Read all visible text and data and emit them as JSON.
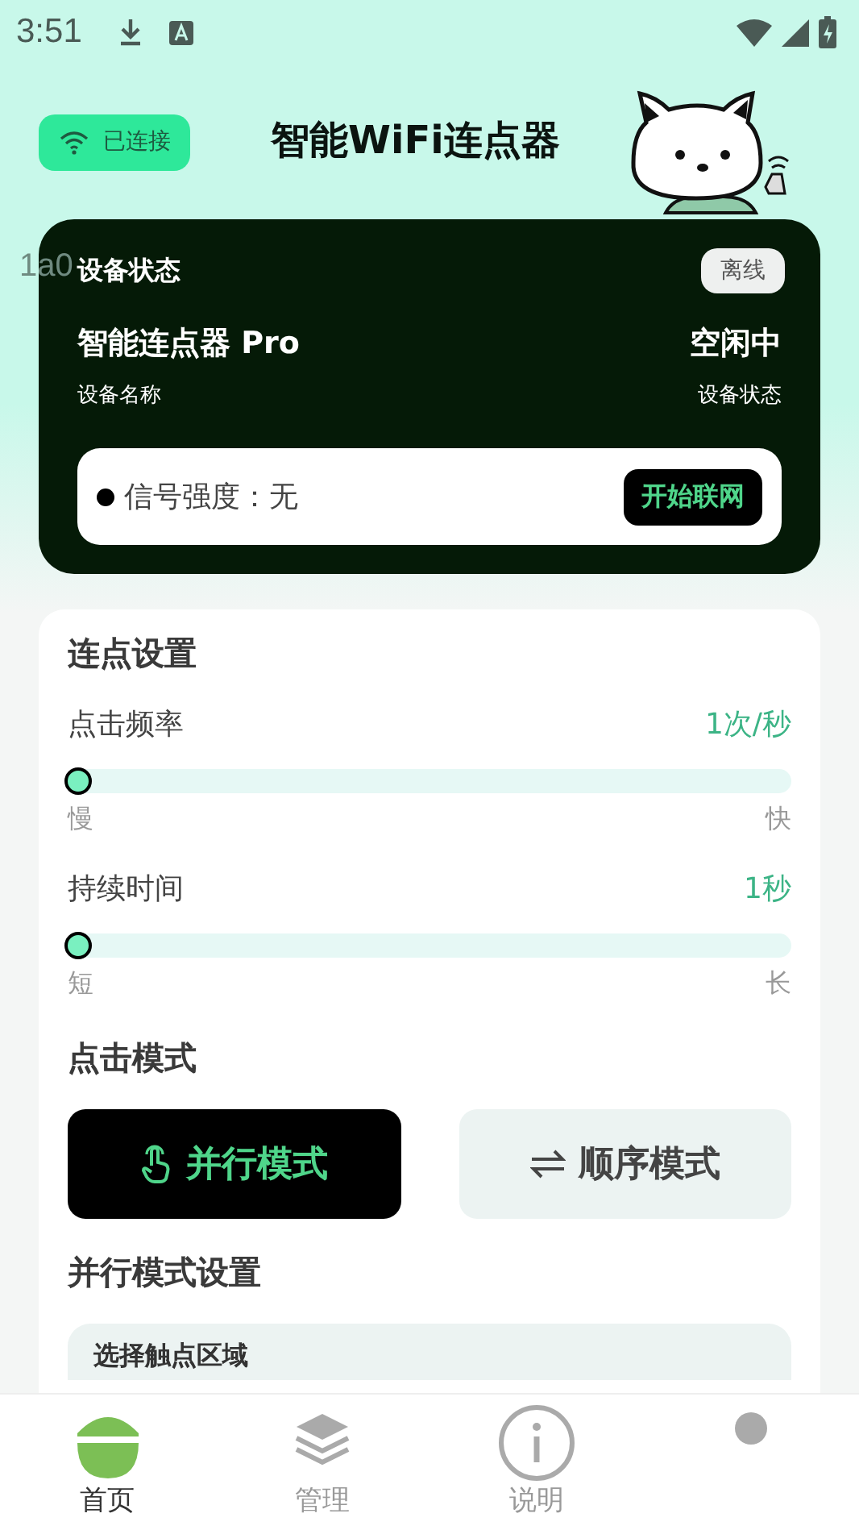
{
  "status_bar": {
    "time": "3:51"
  },
  "header": {
    "connection": "已连接",
    "title": "智能WiFi连点器"
  },
  "background_text": "1a0",
  "device_card": {
    "title": "设备状态",
    "badge": "离线",
    "device_name": "智能连点器 Pro",
    "device_name_label": "设备名称",
    "device_state": "空闲中",
    "device_state_label": "设备状态",
    "signal": "信号强度：无",
    "connect_button": "开始联网"
  },
  "settings": {
    "title": "连点设置",
    "sliders": [
      {
        "label": "点击频率",
        "reading": "1次/秒",
        "level": 0,
        "min_label": "慢",
        "max_label": "快"
      },
      {
        "label": "持续时间",
        "reading": "1秒",
        "level": 0,
        "min_label": "短",
        "max_label": "长"
      }
    ],
    "mode_title": "点击模式",
    "modes": [
      {
        "kind": "parallel",
        "label": "并行模式",
        "selected": true
      },
      {
        "kind": "sequence",
        "label": "顺序模式",
        "selected": false
      }
    ],
    "mode_settings_title": "并行模式设置",
    "area_title": "选择触点区域"
  },
  "nav": [
    {
      "kind": "home",
      "label": "首页",
      "selected": true
    },
    {
      "kind": "layers",
      "label": "管理",
      "selected": false
    },
    {
      "kind": "info",
      "label": "说明",
      "selected": false
    },
    {
      "kind": "dot",
      "selected": false
    }
  ]
}
